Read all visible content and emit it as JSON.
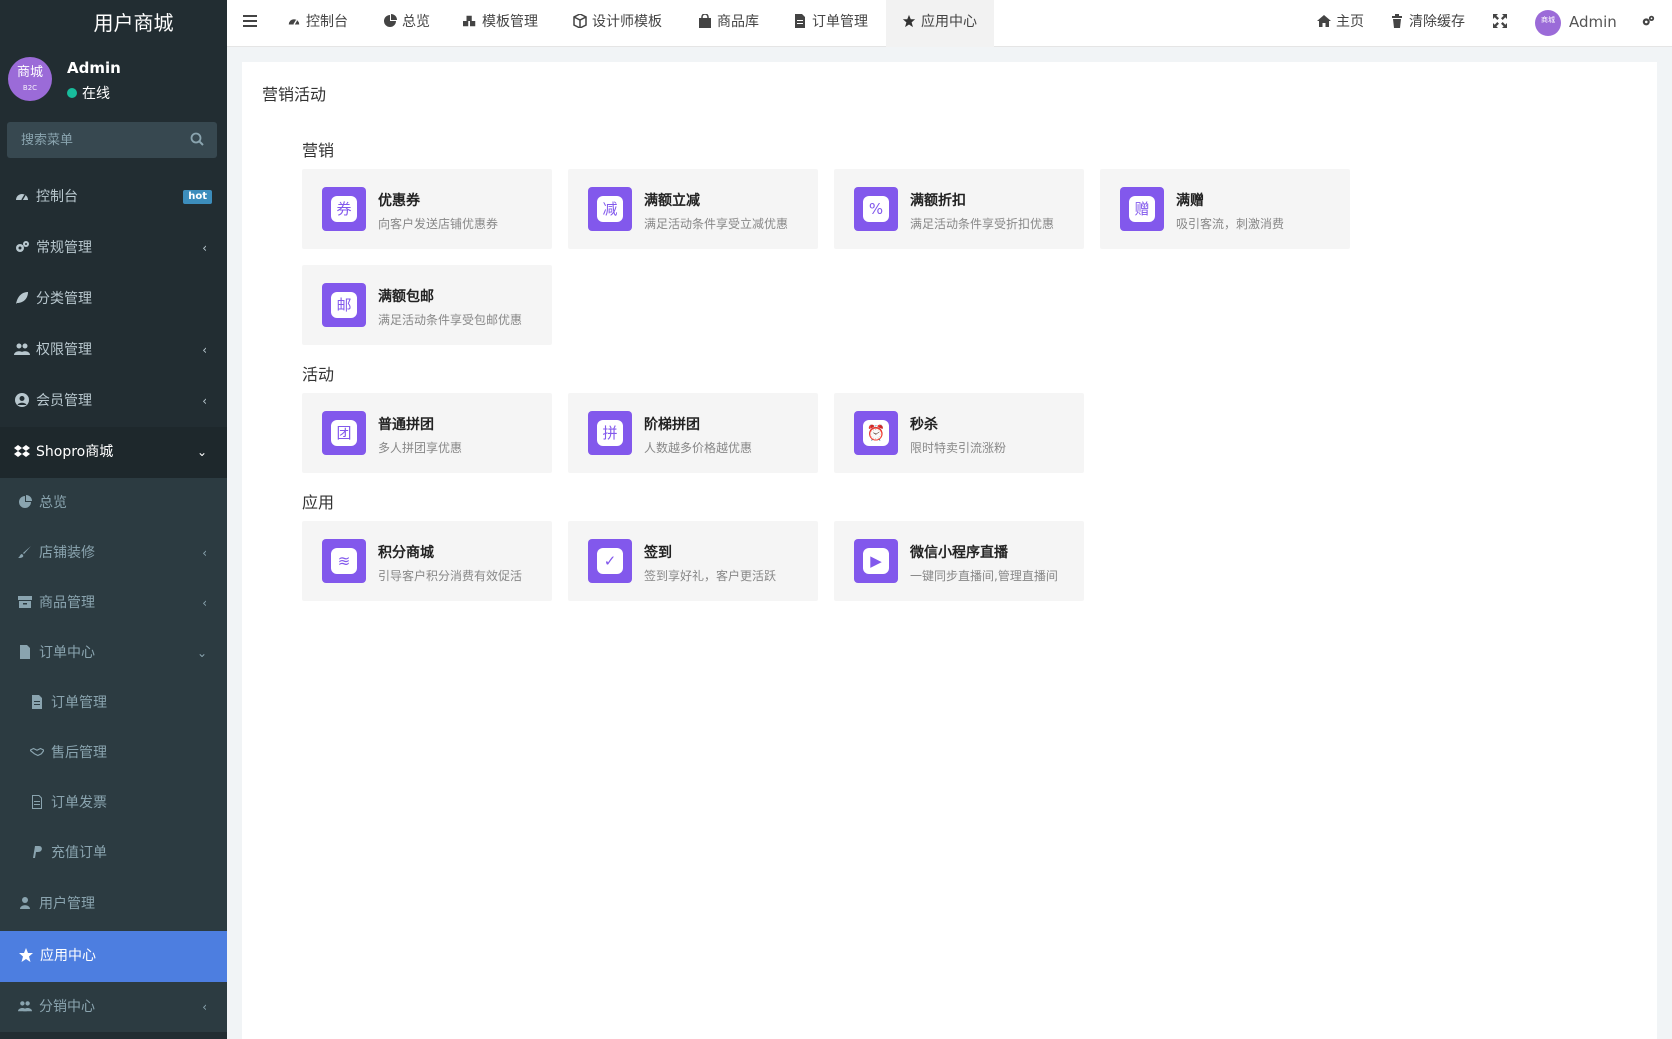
{
  "brand": {
    "title": "用户商城"
  },
  "user": {
    "avatar_text": "商城",
    "avatar_sub": "B2C",
    "name": "Admin",
    "status": "在线"
  },
  "search": {
    "placeholder": "搜索菜单"
  },
  "sidebar": {
    "items": [
      {
        "label": "控制台",
        "icon": "dashboard-icon",
        "badge": "hot"
      },
      {
        "label": "常规管理",
        "icon": "cogs-icon",
        "chevron": "‹"
      },
      {
        "label": "分类管理",
        "icon": "leaf-icon"
      },
      {
        "label": "权限管理",
        "icon": "group-icon",
        "chevron": "‹"
      },
      {
        "label": "会员管理",
        "icon": "user-circle-icon",
        "chevron": "‹"
      },
      {
        "label": "Shopro商城",
        "icon": "dropbox-icon",
        "chevron": "⌄"
      }
    ],
    "shopro": [
      {
        "label": "总览",
        "icon": "pie-chart-icon"
      },
      {
        "label": "店铺装修",
        "icon": "brush-icon",
        "chevron": "‹"
      },
      {
        "label": "商品管理",
        "icon": "archive-icon",
        "chevron": "‹"
      },
      {
        "label": "订单中心",
        "icon": "file-icon",
        "chevron": "⌄"
      }
    ],
    "orders": [
      {
        "label": "订单管理",
        "icon": "file-text-icon"
      },
      {
        "label": "售后管理",
        "icon": "handshake-icon"
      },
      {
        "label": "订单发票",
        "icon": "file-outline-icon"
      },
      {
        "label": "充值订单",
        "icon": "paypal-icon"
      }
    ],
    "after": [
      {
        "label": "用户管理",
        "icon": "user-icon"
      },
      {
        "label": "应用中心",
        "icon": "star-icon"
      },
      {
        "label": "分销中心",
        "icon": "group-icon",
        "chevron": "‹"
      }
    ]
  },
  "topnav": {
    "tabs": [
      {
        "label": "控制台",
        "icon": "dashboard-icon"
      },
      {
        "label": "总览",
        "icon": "pie-chart-icon"
      },
      {
        "label": "模板管理",
        "icon": "cubes-icon"
      },
      {
        "label": "设计师模板",
        "icon": "cube-icon"
      },
      {
        "label": "商品库",
        "icon": "shopping-bag-icon"
      },
      {
        "label": "订单管理",
        "icon": "file-icon"
      },
      {
        "label": "应用中心",
        "icon": "star-icon"
      }
    ],
    "home": "主页",
    "clear_cache": "清除缓存",
    "admin_name": "Admin",
    "admin_avatar_text": "商城"
  },
  "content": {
    "title": "营销活动",
    "sections": [
      {
        "title": "营销",
        "cards": [
          {
            "name": "优惠券",
            "desc": "向客户发送店铺优惠券",
            "glyph": "券"
          },
          {
            "name": "满额立减",
            "desc": "满足活动条件享受立减优惠",
            "glyph": "减"
          },
          {
            "name": "满额折扣",
            "desc": "满足活动条件享受折扣优惠",
            "glyph": "%"
          },
          {
            "name": "满赠",
            "desc": "吸引客流，刺激消费",
            "glyph": "赠"
          },
          {
            "name": "满额包邮",
            "desc": "满足活动条件享受包邮优惠",
            "glyph": "邮"
          }
        ]
      },
      {
        "title": "活动",
        "cards": [
          {
            "name": "普通拼团",
            "desc": "多人拼团享优惠",
            "glyph": "团"
          },
          {
            "name": "阶梯拼团",
            "desc": "人数越多价格越优惠",
            "glyph": "拼"
          },
          {
            "name": "秒杀",
            "desc": "限时特卖引流涨粉",
            "glyph": "⏰"
          }
        ]
      },
      {
        "title": "应用",
        "cards": [
          {
            "name": "积分商城",
            "desc": "引导客户积分消费有效促活",
            "glyph": "≋"
          },
          {
            "name": "签到",
            "desc": "签到享好礼，客户更活跃",
            "glyph": "✓"
          },
          {
            "name": "微信小程序直播",
            "desc": "一键同步直播间,管理直播间",
            "glyph": "▶"
          }
        ]
      }
    ]
  },
  "colors": {
    "sidebar_bg": "#222d32",
    "active_menu": "#4d7ee0",
    "card_icon": "#8258ec",
    "status_online": "#18bc9c",
    "avatar": "#9b6bd8"
  }
}
